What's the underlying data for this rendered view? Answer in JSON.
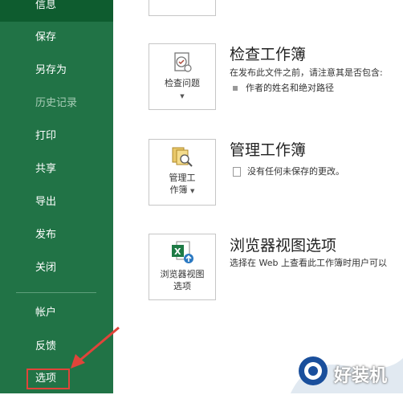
{
  "sidebar": {
    "items": [
      {
        "label": "信息",
        "state": "active"
      },
      {
        "label": "保存",
        "state": "normal"
      },
      {
        "label": "另存为",
        "state": "normal"
      },
      {
        "label": "历史记录",
        "state": "disabled"
      },
      {
        "label": "打印",
        "state": "normal"
      },
      {
        "label": "共享",
        "state": "normal"
      },
      {
        "label": "导出",
        "state": "normal"
      },
      {
        "label": "发布",
        "state": "normal"
      },
      {
        "label": "关闭",
        "state": "normal"
      },
      {
        "label": "帐户",
        "state": "normal"
      },
      {
        "label": "反馈",
        "state": "normal"
      },
      {
        "label": "选项",
        "state": "highlighted"
      }
    ],
    "colors": {
      "background": "#217346",
      "active": "#0e5c2f",
      "annotation": "#e0443a"
    }
  },
  "sections": {
    "inspect": {
      "button_label": "检查问题",
      "title": "检查工作簿",
      "description": "在发布此文件之前，请注意其是否包含:",
      "bullet": "作者的姓名和绝对路径"
    },
    "manage": {
      "button_label_line1": "管理工",
      "button_label_line2": "作簿",
      "title": "管理工作簿",
      "bullet": "没有任何未保存的更改。"
    },
    "browser": {
      "button_label_line1": "浏览器视图",
      "button_label_line2": "选项",
      "title": "浏览器视图选项",
      "description": "选择在 Web 上查看此工作簿时用户可以"
    }
  },
  "watermark": {
    "text": "好装机"
  }
}
